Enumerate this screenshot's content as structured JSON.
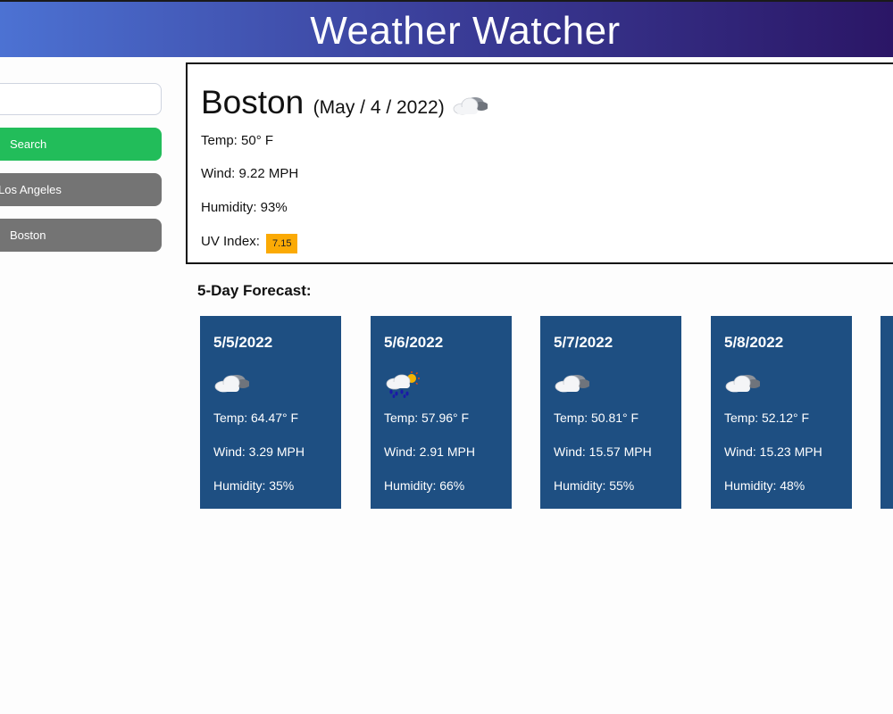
{
  "header": {
    "title": "Weather Watcher"
  },
  "sidebar": {
    "search_placeholder": "",
    "search_button": "Search",
    "history": [
      "Los Angeles",
      "Boston"
    ]
  },
  "current": {
    "city": "Boston",
    "date": "(May / 4 / 2022)",
    "icon": "cloudy-icon",
    "temp": "Temp: 50° F",
    "wind": "Wind: 9.22 MPH",
    "humidity": "Humidity: 93%",
    "uv_label": "UV Index:",
    "uv_value": "7.15",
    "uv_color": "#fbaa05"
  },
  "forecast": {
    "title": "5-Day Forecast:",
    "days": [
      {
        "date": "5/5/2022",
        "icon": "cloudy-icon",
        "temp": "Temp: 64.47° F",
        "wind": "Wind: 3.29 MPH",
        "humidity": "Humidity: 35%"
      },
      {
        "date": "5/6/2022",
        "icon": "rain-sun-icon",
        "temp": "Temp: 57.96° F",
        "wind": "Wind: 2.91 MPH",
        "humidity": "Humidity: 66%"
      },
      {
        "date": "5/7/2022",
        "icon": "cloudy-icon",
        "temp": "Temp: 50.81° F",
        "wind": "Wind: 15.57 MPH",
        "humidity": "Humidity: 55%"
      },
      {
        "date": "5/8/2022",
        "icon": "cloudy-icon",
        "temp": "Temp: 52.12° F",
        "wind": "Wind: 15.23 MPH",
        "humidity": "Humidity: 48%"
      }
    ]
  },
  "colors": {
    "header_start": "#4c72d3",
    "header_end": "#2b1666",
    "search_button": "#22bd5a",
    "history_button": "#747474",
    "card": "#1e4f82"
  }
}
